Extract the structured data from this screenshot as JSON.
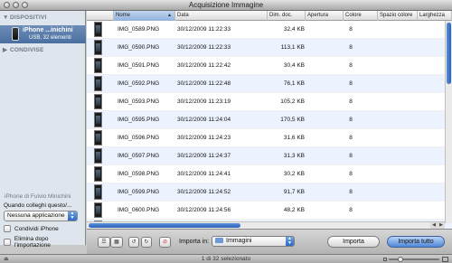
{
  "window": {
    "title": "Acquisizione Immagine"
  },
  "sidebar": {
    "devices_header": "DISPOSITIVI",
    "device": {
      "name": "iPhone ...inichini",
      "info": "USB, 32 elementi"
    },
    "shared_header": "CONDIVISE",
    "owner": "iPhone di Fulvio Minichini",
    "connect_label": "Quando colleghi questo/...",
    "app_value": "Nessuna applicazione",
    "share_label": "Condividi iPhone",
    "delete_label": "Elimina dopo l'importazione"
  },
  "table": {
    "columns": [
      "Nome",
      "Data",
      "Dim. doc.",
      "Apertura",
      "Colore",
      "Spazio colore",
      "Larghezza"
    ],
    "rows": [
      {
        "name": "IMG_0589.PNG",
        "date": "30/12/2009 11:22:33",
        "size": "32,4 KB",
        "colors": "8"
      },
      {
        "name": "IMG_0590.PNG",
        "date": "30/12/2009 11:22:33",
        "size": "113,1 KB",
        "colors": "8"
      },
      {
        "name": "IMG_0591.PNG",
        "date": "30/12/2009 11:22:42",
        "size": "30,4 KB",
        "colors": "8"
      },
      {
        "name": "IMG_0592.PNG",
        "date": "30/12/2009 11:22:48",
        "size": "76,1 KB",
        "colors": "8"
      },
      {
        "name": "IMG_0593.PNG",
        "date": "30/12/2009 11:23:19",
        "size": "105,2 KB",
        "colors": "8"
      },
      {
        "name": "IMG_0595.PNG",
        "date": "30/12/2009 11:24:04",
        "size": "170,5 KB",
        "colors": "8"
      },
      {
        "name": "IMG_0596.PNG",
        "date": "30/12/2009 11:24:23",
        "size": "31,6 KB",
        "colors": "8"
      },
      {
        "name": "IMG_0597.PNG",
        "date": "30/12/2009 11:24:37",
        "size": "31,3 KB",
        "colors": "8"
      },
      {
        "name": "IMG_0598.PNG",
        "date": "30/12/2009 11:24:41",
        "size": "30,2 KB",
        "colors": "8"
      },
      {
        "name": "IMG_0599.PNG",
        "date": "30/12/2009 11:24:52",
        "size": "91,7 KB",
        "colors": "8"
      },
      {
        "name": "IMG_0600.PNG",
        "date": "30/12/2009 11:24:56",
        "size": "48,2 KB",
        "colors": "8"
      },
      {
        "name": "IMG_0601.PNG",
        "date": "30/12/2009 11:25:12",
        "size": "36,1 KB",
        "colors": "8"
      }
    ]
  },
  "toolbar": {
    "import_in_label": "Importa in:",
    "destination": "Immagini",
    "import_button": "Importa",
    "import_all_button": "Importa tutto"
  },
  "status": {
    "text": "1 di 32 selezionato"
  }
}
